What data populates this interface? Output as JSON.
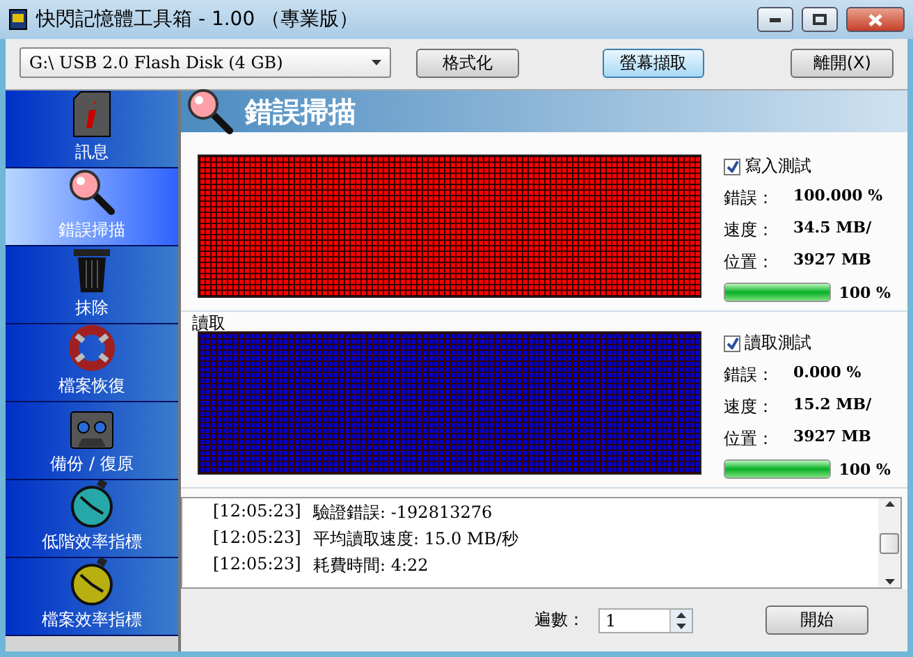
{
  "window": {
    "title": "快閃記憶體工具箱 - 1.00 （專業版）"
  },
  "toolbar": {
    "drive": "G:\\ USB 2.0 Flash Disk (4 GB)",
    "buttons": [
      {
        "label": "格式化",
        "focused": false
      },
      {
        "label": "螢幕擷取",
        "focused": true
      },
      {
        "label": "離開(X)",
        "focused": false
      }
    ]
  },
  "sidebar": {
    "items": [
      {
        "label": "訊息",
        "kind": "info",
        "selected": false
      },
      {
        "label": "錯誤掃描",
        "kind": "magnifier",
        "selected": true
      },
      {
        "label": "抹除",
        "kind": "trash",
        "selected": false
      },
      {
        "label": "檔案恢復",
        "kind": "lifebuoy",
        "selected": false
      },
      {
        "label": "備份 / 復原",
        "kind": "tape",
        "selected": false
      },
      {
        "label": "低階效率指標",
        "kind": "stopwatch-teal",
        "selected": false
      },
      {
        "label": "檔案效率指標",
        "kind": "stopwatch-olive",
        "selected": false
      }
    ]
  },
  "header": {
    "title": "錯誤掃描"
  },
  "sections": [
    {
      "check": "寫入測試",
      "checked": true,
      "color": "#ff0000",
      "stats": [
        {
          "label": "錯誤：",
          "value": "100.000 %"
        },
        {
          "label": "速度：",
          "value": "34.5 MB/"
        },
        {
          "label": "位置：",
          "value": "3927 MB"
        }
      ],
      "level": 1,
      "percent": "100 %"
    },
    {
      "label": "讀取",
      "check": "讀取測試",
      "checked": true,
      "color": "#0000cc",
      "stats": [
        {
          "label": "錯誤：",
          "value": "0.000 %"
        },
        {
          "label": "速度：",
          "value": "15.2 MB/"
        },
        {
          "label": "位置：",
          "value": "3927 MB"
        }
      ],
      "level": 1,
      "percent": "100 %"
    }
  ],
  "log": [
    {
      "time": "[12:05:23]",
      "message": "驗證錯誤: -192813276"
    },
    {
      "time": "[12:05:23]",
      "message": "平均讀取速度: 15.0 MB/秒"
    },
    {
      "time": "[12:05:23]",
      "message": "耗費時間: 4:22"
    }
  ],
  "footer": {
    "passes_label": "遍數：",
    "passes": "1",
    "start": "開始"
  }
}
